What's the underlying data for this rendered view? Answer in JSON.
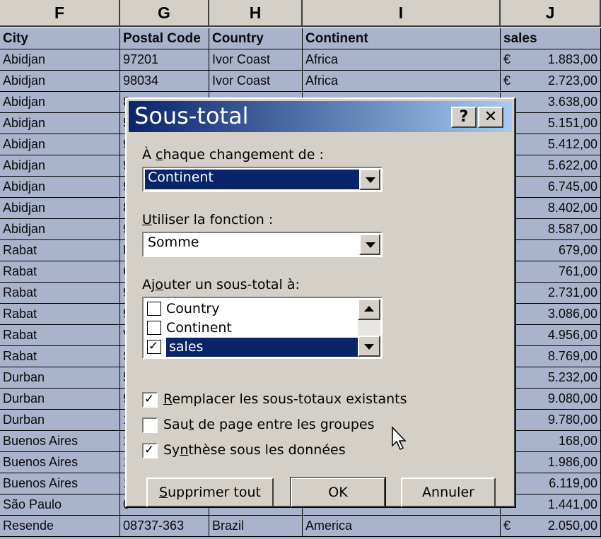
{
  "columns": [
    "F",
    "G",
    "H",
    "I",
    "J"
  ],
  "header_row": {
    "city": "City",
    "postal": "Postal Code",
    "country": "Country",
    "continent": "Continent",
    "sales": "sales"
  },
  "rows": [
    {
      "city": "Abidjan",
      "postal": "97201",
      "country": "Ivor Coast",
      "continent": "Africa",
      "cur": "€",
      "sales": "1.883,00"
    },
    {
      "city": "Abidjan",
      "postal": "98034",
      "country": "Ivor Coast",
      "continent": "Africa",
      "cur": "€",
      "sales": "2.723,00"
    },
    {
      "city": "Abidjan",
      "postal": "8",
      "country": "",
      "continent": "",
      "cur": "",
      "sales": "3.638,00"
    },
    {
      "city": "Abidjan",
      "postal": "5",
      "country": "",
      "continent": "",
      "cur": "",
      "sales": "5.151,00"
    },
    {
      "city": "Abidjan",
      "postal": "9",
      "country": "",
      "continent": "",
      "cur": "",
      "sales": "5.412,00"
    },
    {
      "city": "Abidjan",
      "postal": "9",
      "country": "",
      "continent": "",
      "cur": "",
      "sales": "5.622,00"
    },
    {
      "city": "Abidjan",
      "postal": "9",
      "country": "",
      "continent": "",
      "cur": "",
      "sales": "6.745,00"
    },
    {
      "city": "Abidjan",
      "postal": "8",
      "country": "",
      "continent": "",
      "cur": "",
      "sales": "8.402,00"
    },
    {
      "city": "Abidjan",
      "postal": "9",
      "country": "",
      "continent": "",
      "cur": "",
      "sales": "8.587,00"
    },
    {
      "city": "Rabat",
      "postal": "L",
      "country": "",
      "continent": "",
      "cur": "",
      "sales": "679,00"
    },
    {
      "city": "Rabat",
      "postal": "C",
      "country": "",
      "continent": "",
      "cur": "",
      "sales": "761,00"
    },
    {
      "city": "Rabat",
      "postal": "9",
      "country": "",
      "continent": "",
      "cur": "",
      "sales": "2.731,00"
    },
    {
      "city": "Rabat",
      "postal": "9",
      "country": "",
      "continent": "",
      "cur": "",
      "sales": "3.086,00"
    },
    {
      "city": "Rabat",
      "postal": "V",
      "country": "",
      "continent": "",
      "cur": "",
      "sales": "4.956,00"
    },
    {
      "city": "Rabat",
      "postal": "S",
      "country": "",
      "continent": "",
      "cur": "",
      "sales": "8.769,00"
    },
    {
      "city": "Durban",
      "postal": "5",
      "country": "",
      "continent": "",
      "cur": "",
      "sales": "5.232,00"
    },
    {
      "city": "Durban",
      "postal": "9",
      "country": "",
      "continent": "",
      "cur": "",
      "sales": "9.080,00"
    },
    {
      "city": "Durban",
      "postal": "1",
      "country": "",
      "continent": "",
      "cur": "",
      "sales": "9.780,00"
    },
    {
      "city": "Buenos Aires",
      "postal": "1",
      "country": "",
      "continent": "",
      "cur": "",
      "sales": "168,00"
    },
    {
      "city": "Buenos Aires",
      "postal": "1",
      "country": "",
      "continent": "",
      "cur": "",
      "sales": "1.986,00"
    },
    {
      "city": "Buenos Aires",
      "postal": "1",
      "country": "",
      "continent": "",
      "cur": "",
      "sales": "6.119,00"
    },
    {
      "city": "São Paulo",
      "postal": "0",
      "country": "",
      "continent": "",
      "cur": "",
      "sales": "1.441,00"
    },
    {
      "city": "Resende",
      "postal": "08737-363",
      "country": "Brazil",
      "continent": "America",
      "cur": "€",
      "sales": "2.050,00"
    }
  ],
  "dialog": {
    "title": "Sous-total",
    "help_button": "?",
    "close_button": "✕",
    "change_label_pre": "À ",
    "change_label_u": "c",
    "change_label_post": "haque changement de :",
    "change_value": "Continent",
    "function_label_u": "U",
    "function_label_post": "tiliser la fonction :",
    "function_value": "Somme",
    "add_label_pre": "Aj",
    "add_label_u": "o",
    "add_label_post": "uter un sous-total à:",
    "list_items": [
      "Country",
      "Continent",
      "sales"
    ],
    "replace_u": "R",
    "replace_post": "emplacer les sous-totaux existants",
    "pagebreak_pre": "Sau",
    "pagebreak_u": "t",
    "pagebreak_post": " de page entre les groupes",
    "summary_pre": "Sy",
    "summary_u": "n",
    "summary_post": "thèse sous les données",
    "remove_all_u": "S",
    "remove_all_post": "upprimer tout",
    "ok": "OK",
    "cancel": "Annuler"
  }
}
